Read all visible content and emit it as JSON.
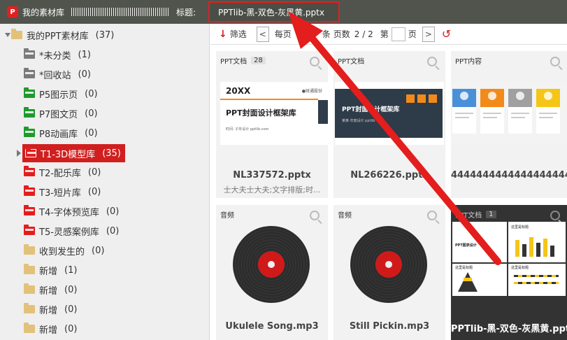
{
  "app": {
    "title": "我的素材库",
    "title_label": "标题:",
    "title_value": "PPTlib-黑-双色-灰黑黄.pptx"
  },
  "sidebar": {
    "items": [
      {
        "label": "我的PPT素材库",
        "count": "(37)",
        "color": "tan"
      },
      {
        "label": "*未分类",
        "count": "(1)",
        "color": "gray"
      },
      {
        "label": "*回收站",
        "count": "(0)",
        "color": "gray"
      },
      {
        "label": "P5图示页",
        "count": "(0)",
        "color": "green"
      },
      {
        "label": "P7图文页",
        "count": "(0)",
        "color": "green"
      },
      {
        "label": "P8动画库",
        "count": "(0)",
        "color": "green"
      },
      {
        "label": "T1-3D模型库",
        "count": "(35)",
        "color": "red"
      },
      {
        "label": "T2-配乐库",
        "count": "(0)",
        "color": "red"
      },
      {
        "label": "T3-短片库",
        "count": "(0)",
        "color": "red"
      },
      {
        "label": "T4-字体预览库",
        "count": "(0)",
        "color": "red"
      },
      {
        "label": "T5-灵感案例库",
        "count": "(0)",
        "color": "red"
      },
      {
        "label": "收到发生的",
        "count": "(0)",
        "color": "tan"
      },
      {
        "label": "新增",
        "count": "(1)",
        "color": "tan"
      },
      {
        "label": "新增",
        "count": "(0)",
        "color": "tan"
      },
      {
        "label": "新增",
        "count": "(0)",
        "color": "tan"
      },
      {
        "label": "新增",
        "count": "(0)",
        "color": "tan"
      }
    ]
  },
  "toolbar": {
    "filter_label": "筛选",
    "per_page_label": "每页",
    "items_label": "条",
    "pages_label": "页数",
    "pages_value": "2 / 2",
    "goto_prefix": "第",
    "goto_suffix": "页",
    "prev": "<",
    "next": ">"
  },
  "cards": [
    {
      "tag": "PPT文档",
      "badge": "28",
      "name": "NL337572.pptx",
      "sub": "士大夫士大夫;文字排版;时...",
      "thumb": {
        "hdr": "20XX",
        "logo": "●财通股份",
        "title": "PPT封面设计框架库",
        "foot": "时间: 子年设计    pptlib.com"
      }
    },
    {
      "tag": "PPT文档",
      "badge": "",
      "name": "NL266226.pptx",
      "sub": "",
      "thumb": {
        "title": "PPT封面设计框架库",
        "meta": "某某·年度设计    pptlib"
      }
    },
    {
      "tag": "PPT内容",
      "badge": "",
      "name": "4444444444444444444...",
      "sub": "",
      "thumb": {
        "col_title": "内容标题"
      }
    },
    {
      "tag": "音频",
      "badge": "",
      "name": "Ukulele Song.mp3",
      "sub": ""
    },
    {
      "tag": "音频",
      "badge": "",
      "name": "Still Pickin.mp3",
      "sub": ""
    },
    {
      "tag": "PPT文档",
      "badge": "1",
      "name": "PPTlib-黑-双色-灰黑黄.pptx",
      "sub": "",
      "thumb": {
        "t1": "PPT图表设计",
        "t2": "这里是标题",
        "t3": "这里是标题",
        "t4": "这里是标题"
      }
    }
  ],
  "colors": {
    "accent_red": "#d11f1f",
    "titlebar": "#51544c"
  }
}
